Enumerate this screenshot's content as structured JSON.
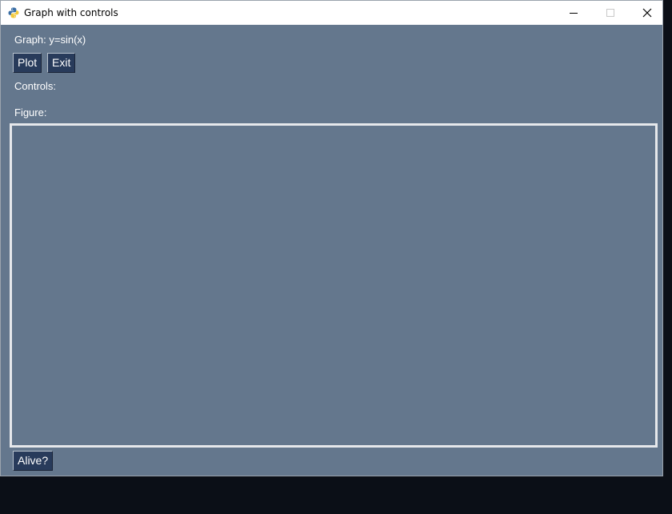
{
  "window": {
    "title": "Graph with controls",
    "icon": "python-icon"
  },
  "graph_label": "Graph: y=sin(x)",
  "buttons": {
    "plot": "Plot",
    "exit": "Exit",
    "alive": "Alive?"
  },
  "controls_label": "Controls:",
  "figure_label": "Figure:",
  "colors": {
    "background": "#64778d",
    "button": "#283b5b",
    "figure_border": "#e6e8eb",
    "desktop": "#0b0f17"
  }
}
